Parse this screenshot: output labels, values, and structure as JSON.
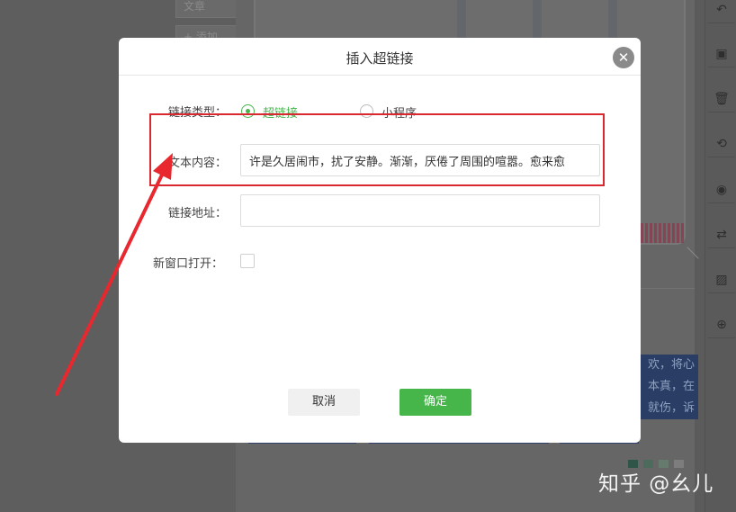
{
  "background": {
    "left_buttons": [
      "文章",
      "+ 添加"
    ],
    "blue_text_lines": [
      "欢，将心",
      "本真，在",
      "就伤，诉"
    ],
    "dot_colors": [
      "#2e5548",
      "#4d6b5c",
      "#667a6e",
      "#7d7d7d"
    ]
  },
  "toolbar": {
    "icons": [
      "undo-icon",
      "save-icon",
      "delete-icon",
      "history-icon",
      "preview-icon",
      "swap-icon",
      "image-icon",
      "zoom-icon"
    ],
    "glyphs": [
      "↶",
      "▣",
      "🗑",
      "⟲",
      "◉",
      "⇄",
      "▨",
      "⊕"
    ]
  },
  "watermark": "知乎 @幺儿",
  "dialog": {
    "title": "插入超链接",
    "close_glyph": "✕",
    "link_type": {
      "label": "链接类型：",
      "options": [
        {
          "label": "超链接",
          "selected": true
        },
        {
          "label": "小程序",
          "selected": false
        }
      ]
    },
    "text_content": {
      "label": "文本内容：",
      "value": "许是久居闹市，扰了安静。渐渐，厌倦了周围的喧嚣。愈来愈"
    },
    "link_url": {
      "label": "链接地址：",
      "value": ""
    },
    "new_window": {
      "label": "新窗口打开：",
      "checked": false
    },
    "cancel_label": "取消",
    "ok_label": "确定"
  },
  "colors": {
    "accent_green": "#46b64b",
    "annotation_red": "#d9282f"
  }
}
